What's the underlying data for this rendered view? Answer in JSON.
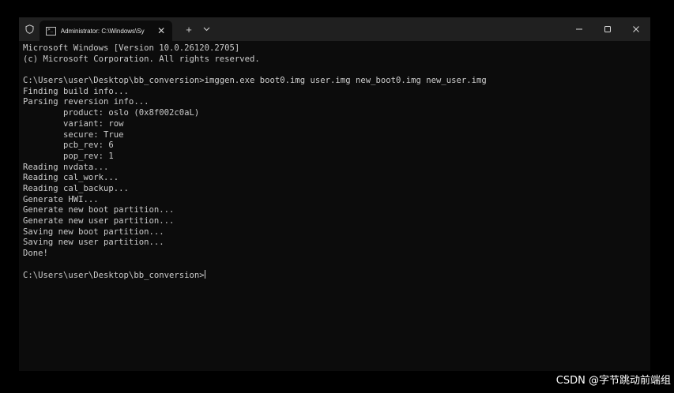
{
  "tab": {
    "title": "Administrator: C:\\Windows\\Sy",
    "icon": "terminal-icon",
    "close_glyph": "✕"
  },
  "toolbar": {
    "new_tab_glyph": "+",
    "dropdown_glyph": "⌄"
  },
  "window_controls": {
    "minimize": "minimize-icon",
    "maximize": "maximize-icon",
    "close": "close-icon"
  },
  "terminal": {
    "lines": [
      "Microsoft Windows [Version 10.0.26120.2705]",
      "(c) Microsoft Corporation. All rights reserved.",
      "",
      "C:\\Users\\user\\Desktop\\bb_conversion>imggen.exe boot0.img user.img new_boot0.img new_user.img",
      "Finding build info...",
      "Parsing reversion info...",
      "        product: oslo (0x8f002c0aL)",
      "        variant: row",
      "        secure: True",
      "        pcb_rev: 6",
      "        pop_rev: 1",
      "Reading nvdata...",
      "Reading cal_work...",
      "Reading cal_backup...",
      "Generate HWI...",
      "Generate new boot partition...",
      "Generate new user partition...",
      "Saving new boot partition...",
      "Saving new user partition...",
      "Done!",
      ""
    ],
    "prompt": "C:\\Users\\user\\Desktop\\bb_conversion>"
  },
  "watermark": "CSDN @字节跳动前端组",
  "colors": {
    "terminal_bg": "#0c0c0c",
    "titlebar_bg": "#202020",
    "text": "#cccccc"
  }
}
